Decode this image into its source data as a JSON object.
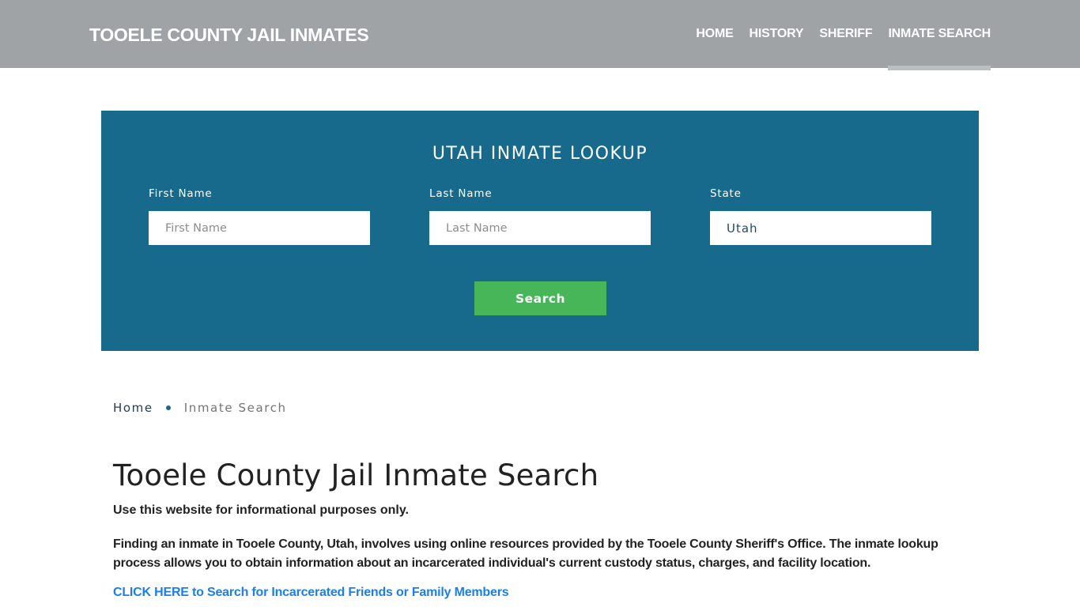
{
  "header": {
    "brand": "TOOELE COUNTY JAIL INMATES",
    "nav": [
      {
        "label": "HOME",
        "active": false
      },
      {
        "label": "HISTORY",
        "active": false
      },
      {
        "label": "SHERIFF",
        "active": false
      },
      {
        "label": "INMATE SEARCH",
        "active": true
      }
    ]
  },
  "lookup": {
    "title": "UTAH INMATE LOOKUP",
    "fields": [
      {
        "label": "First Name",
        "placeholder": "First Name",
        "value": ""
      },
      {
        "label": "Last Name",
        "placeholder": "Last Name",
        "value": ""
      },
      {
        "label": "State",
        "placeholder": "",
        "value": "Utah"
      }
    ],
    "search_label": "Search"
  },
  "breadcrumb": {
    "home": "Home",
    "current": "Inmate Search"
  },
  "content": {
    "title": "Tooele County Jail Inmate Search",
    "disclaimer": "Use this website for informational purposes only.",
    "intro": "Finding an inmate in Tooele County, Utah, involves using online resources provided by the Tooele County Sheriff's Office. The inmate lookup process allows you to obtain information about an incarcerated individual's current custody status, charges, and facility location.",
    "cta": "CLICK HERE to Search for Incarcerated Friends or Family Members"
  },
  "colors": {
    "header_bg": "#9fa3a6",
    "lookup_bg": "#186a8d",
    "search_button": "#46b658",
    "link": "#1a7fe8"
  }
}
